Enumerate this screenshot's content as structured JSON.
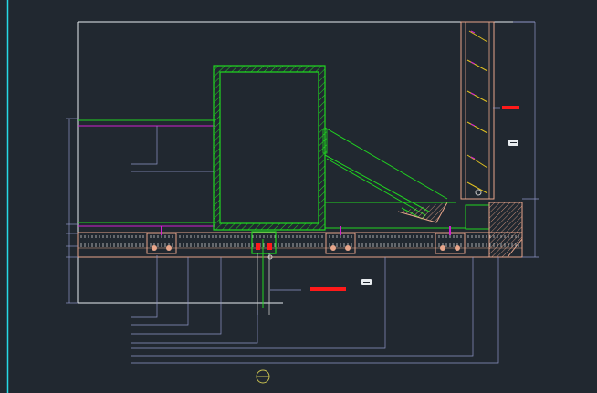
{
  "drawing": {
    "background": "#212830",
    "colors": {
      "frame": "#e8ecef",
      "steel_green": "#21d421",
      "magenta": "#d020d0",
      "salmon": "#e8a58a",
      "annotation_gray": "#8f96c8",
      "red_marker": "#ff1a1a",
      "cyan_edge": "#26d9e6",
      "yellow_anchor": "#e0c020",
      "wood_hatch": "#c8c8c8"
    },
    "section_symbol": "section-circle-icon",
    "callout_icons": [
      "note-tag-icon",
      "note-tag-icon"
    ]
  }
}
